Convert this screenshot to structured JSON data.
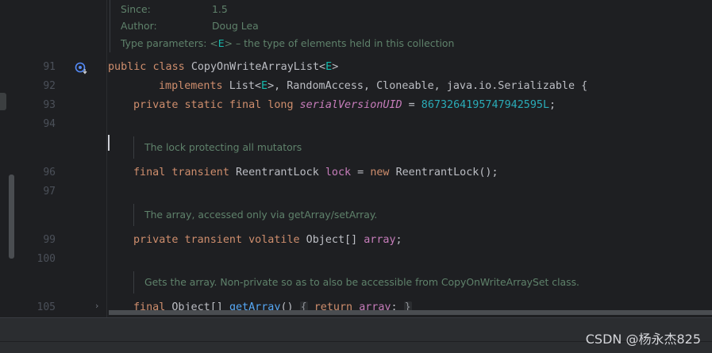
{
  "javadoc_top": {
    "since_label": "Since:",
    "since_value": "1.5",
    "author_label": "Author:",
    "author_value": "Doug Lea",
    "type_params_label": "Type parameters:",
    "type_params_lt": "<",
    "type_params_e": "E",
    "type_params_gt": ">",
    "type_params_desc": " – the type of elements held in this collection"
  },
  "line_numbers": [
    "91",
    "92",
    "93",
    "94",
    "96",
    "97",
    "99",
    "100",
    "105"
  ],
  "code": {
    "l91": {
      "kw1": "public",
      "kw2": "class",
      "name": "CopyOnWriteArrayList<",
      "tp": "E",
      "end": ">"
    },
    "l92": {
      "kw": "implements",
      "pre": "List<",
      "tp": "E",
      "rest": ">, RandomAccess, Cloneable, java.io.Serializable {"
    },
    "l93": {
      "kw": "private static final long",
      "field": "serialVersionUID",
      "eq": " = ",
      "num": "8673264195747942595L",
      "end": ";"
    },
    "l96": {
      "kw": "final transient",
      "type": "ReentrantLock",
      "field": "lock",
      "eq": " = ",
      "kw2": "new",
      "rest": "ReentrantLock();"
    },
    "l99": {
      "kw": "private transient volatile",
      "type": "Object[]",
      "field": "array",
      "end": ";"
    },
    "l105": {
      "kw": "final",
      "type": "Object[]",
      "fn": "getArray",
      "parens": "()",
      "fold1": "{",
      "kw2": "return",
      "field": "array",
      "semi": ";",
      "fold2": "}"
    }
  },
  "docs": {
    "lock": "The lock protecting all mutators",
    "array": "The array, accessed only via getArray/setArray.",
    "get_array": "Gets the array. Non-private so as to also be accessible from CopyOnWriteArraySet class."
  },
  "icons": {
    "override": "override-marker-icon",
    "fold": "chevron-right-icon"
  },
  "chevron_glyph": "›",
  "watermark": "CSDN @杨永杰825",
  "colors": {
    "background": "#1e1f22",
    "keyword": "#cf8e6d",
    "type_param": "#16baac",
    "field": "#c77dbb",
    "number": "#2aacb8",
    "method": "#56a8f5",
    "doc": "#5f826b",
    "line_number": "#4b5059"
  }
}
